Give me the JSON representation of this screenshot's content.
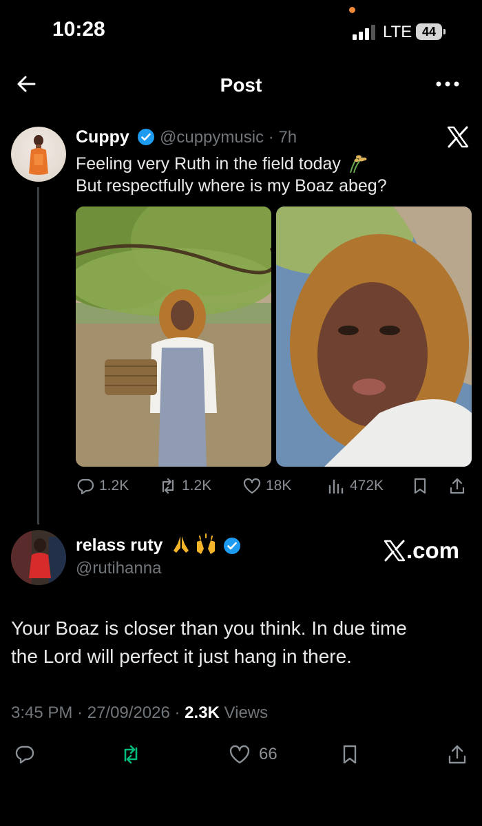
{
  "status_bar": {
    "time": "10:28",
    "network": "LTE",
    "battery": "44"
  },
  "header": {
    "title": "Post",
    "back_icon": "arrow-left-icon",
    "more_icon": "more-horizontal-icon"
  },
  "quoted_post": {
    "author": "Cuppy",
    "meta": "@cuppymusic · 7h",
    "text_line1": "Feeling very Ruth in the field today",
    "text_line2": "But respectfully where is my Boaz abeg?",
    "emoji": "sheaf-of-rice-icon",
    "stats": {
      "replies": "1.2K",
      "reposts": "1.2K",
      "likes": "18K",
      "views": "472K"
    }
  },
  "reply": {
    "author": "relass ruty",
    "handle": "@rutihanna",
    "brand_text": ".com",
    "text_line1": "Your Boaz is closer than you think. In due time",
    "text_line2": "the Lord will perfect it just hang in there.",
    "time": "3:45 PM",
    "date": "27/09/2026",
    "views_count": "2.3K",
    "views_label": "Views",
    "likes": "66"
  },
  "colors": {
    "background": "#000000",
    "text": "#e7e9ea",
    "muted": "#71767b",
    "verified": "#1d9bf0",
    "repost_green": "#00ba7c"
  }
}
